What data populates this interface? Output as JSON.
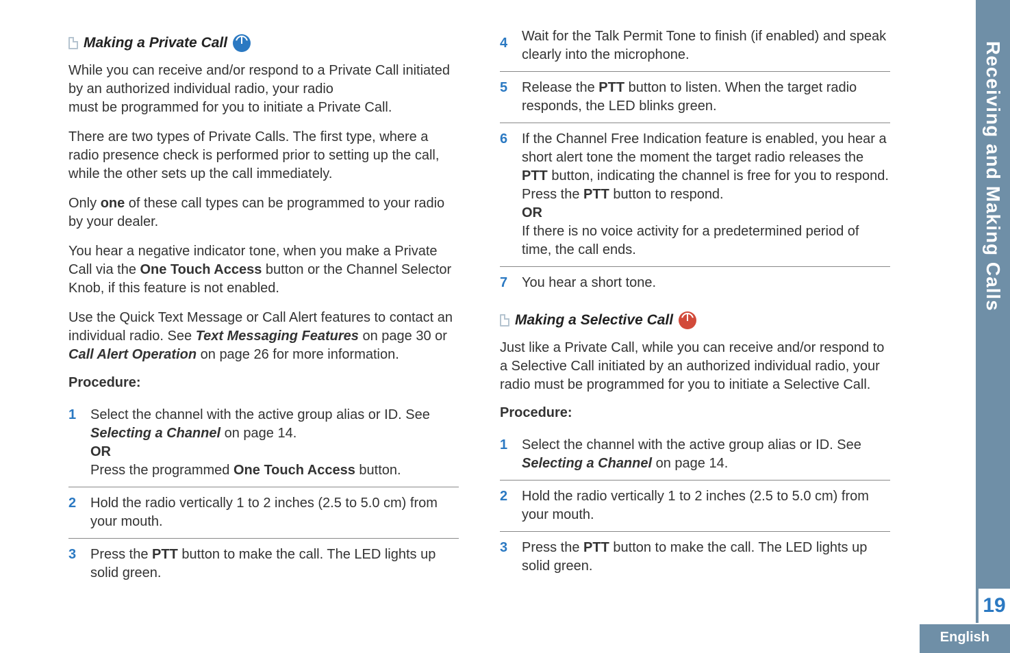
{
  "sideTab": "Receiving and Making Calls",
  "pageNumber": "19",
  "footerLang": "English",
  "col1": {
    "sec1": {
      "title": "Making a Private Call",
      "p1a": "While you can receive and/or respond to a Private Call initiated by an authorized individual radio, your radio",
      "p1b": "must be programmed for you to initiate a Private Call.",
      "p2": "There are two types of Private Calls. The first type, where a radio presence check is performed prior to setting up the call, while the other sets up the call immediately.",
      "p3a": "Only ",
      "p3b": "one",
      "p3c": " of these call types can be programmed to your radio by your dealer.",
      "p4a": "You hear a negative indicator tone, when you make a Private Call via the ",
      "p4b": "One Touch Access",
      "p4c": " button or the Channel Selector Knob, if this feature is not enabled.",
      "p5a": "Use the Quick Text Message or Call Alert features to contact an individual radio. See ",
      "p5b": "Text Messaging Features",
      "p5c": " on page 30 or ",
      "p5d": "Call Alert Operation",
      "p5e": " on page 26 for more information.",
      "procLabel": "Procedure:",
      "steps": {
        "s1a": "Select the channel with the active group alias or ID. See ",
        "s1b": "Selecting a Channel",
        "s1c": " on page 14.",
        "s1or": "OR",
        "s1d": "Press the programmed ",
        "s1e": "One Touch Access",
        "s1f": " button.",
        "s2": "Hold the radio vertically 1 to 2 inches (2.5 to 5.0 cm) from your mouth.",
        "s3a": "Press the ",
        "s3b": "PTT",
        "s3c": " button to make the call. The LED lights up solid green."
      }
    }
  },
  "col2": {
    "stepsCont": {
      "s4": "Wait for the Talk Permit Tone to finish (if enabled) and speak clearly into the microphone.",
      "s5a": "Release the ",
      "s5b": "PTT",
      "s5c": " button to listen. When the target radio responds, the LED blinks green.",
      "s6a": "If the Channel Free Indication feature is enabled, you hear a short alert tone the moment the target radio releases the ",
      "s6b": "PTT",
      "s6c": " button, indicating the channel is free for you to respond. Press the ",
      "s6d": "PTT",
      "s6e": " button to respond.",
      "s6or": "OR",
      "s6f": "If there is no voice activity for a predetermined period of time, the call ends.",
      "s7": "You hear a short tone."
    },
    "sec2": {
      "title": "Making a Selective Call",
      "p1": "Just like a Private Call, while you can receive and/or respond to a Selective Call initiated by an authorized individual radio, your radio must be programmed for you to initiate a Selective Call.",
      "procLabel": "Procedure:",
      "steps": {
        "s1a": "Select the channel with the active group alias or ID. See ",
        "s1b": "Selecting a Channel",
        "s1c": " on page 14.",
        "s2": "Hold the radio vertically 1 to 2 inches (2.5 to 5.0 cm) from your mouth.",
        "s3a": "Press the ",
        "s3b": "PTT",
        "s3c": " button to make the call. The LED lights up solid green."
      }
    }
  }
}
